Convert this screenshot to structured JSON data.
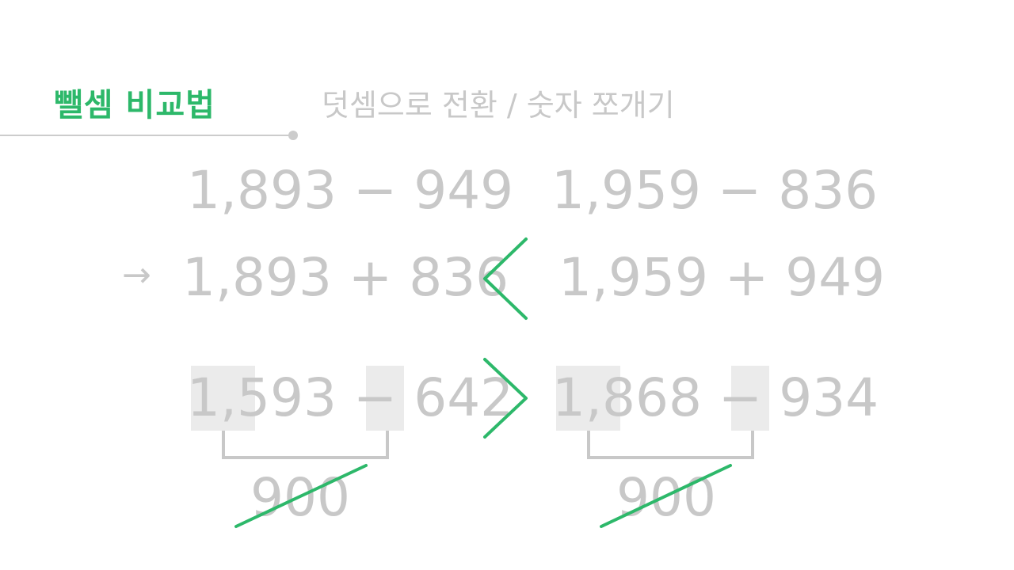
{
  "header": {
    "title": "뺄셈 비교법",
    "subtitle": "덧셈으로 전환 / 숫자 쪼개기"
  },
  "example1": {
    "left_original": "1,893 − 949",
    "right_original": "1,959 − 836",
    "arrow": "→",
    "left_converted": "1,893 + 836",
    "right_converted": "1,959 + 949",
    "comparison": "<"
  },
  "example2": {
    "left_expr": "1,593 − 642",
    "right_expr": "1,868 − 934",
    "comparison": ">",
    "left_pair_sum": "900",
    "right_pair_sum": "900"
  },
  "colors": {
    "accent": "#2db86a",
    "text_muted": "#c8c8c8",
    "highlight": "#ebebeb"
  }
}
